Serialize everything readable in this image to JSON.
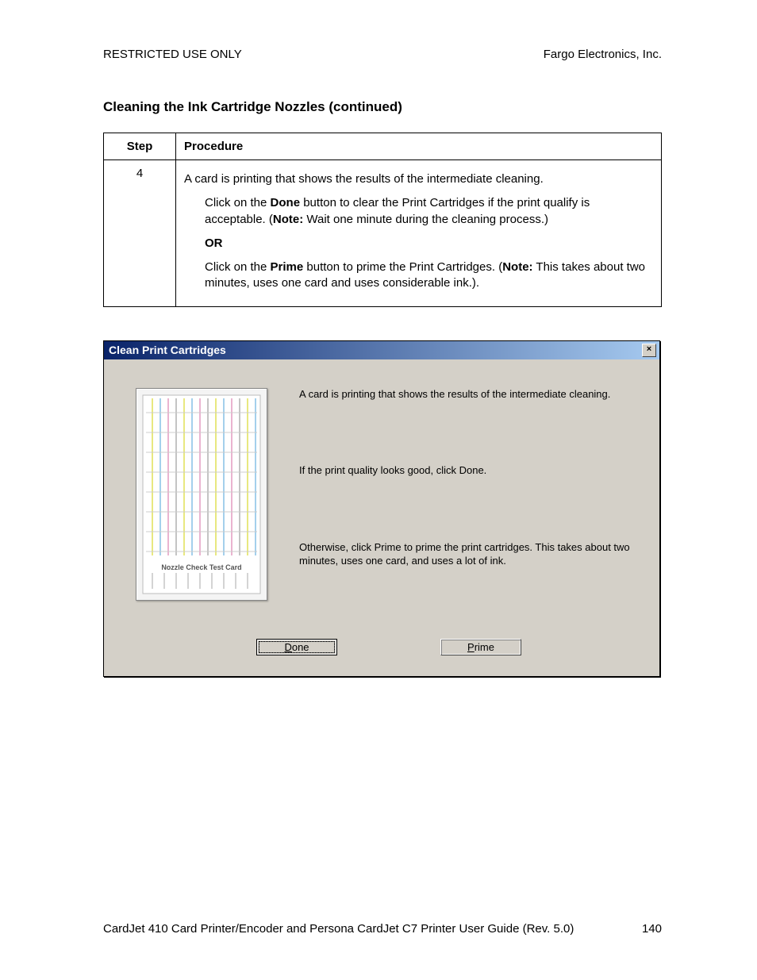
{
  "header": {
    "left": "RESTRICTED USE ONLY",
    "right": "Fargo Electronics, Inc."
  },
  "section_title": "Cleaning the Ink Cartridge Nozzles (continued)",
  "table": {
    "headers": {
      "step": "Step",
      "procedure": "Procedure"
    },
    "row": {
      "step": "4",
      "p1": "A card is printing that shows the results of the intermediate cleaning.",
      "p2_pre": "Click on the ",
      "p2_bold": "Done",
      "p2_mid": " button to clear the Print Cartridges if the print qualify is acceptable. (",
      "p2_note": "Note:",
      "p2_post": "  Wait one minute during the cleaning process.)",
      "or": "OR",
      "p3_pre": "Click on the ",
      "p3_bold": "Prime",
      "p3_mid": " button to prime the Print Cartridges. (",
      "p3_note": "Note:",
      "p3_post": "  This takes about two minutes, uses one card and uses considerable ink.)."
    }
  },
  "dialog": {
    "title": "Clean Print Cartridges",
    "close_icon": "×",
    "card_label": "Nozzle Check Test Card",
    "msg1": "A card is printing that shows the results of the intermediate cleaning.",
    "msg2": "If the print quality looks good, click Done.",
    "msg3": "Otherwise, click Prime to prime the print cartridges.  This takes about two minutes, uses one card, and uses a lot of ink.",
    "buttons": {
      "done_accel": "D",
      "done_rest": "one",
      "prime_accel": "P",
      "prime_rest": "rime"
    }
  },
  "footer": {
    "text": "CardJet 410 Card Printer/Encoder and Persona CardJet C7 Printer User Guide (Rev. 5.0)",
    "page": "140"
  }
}
